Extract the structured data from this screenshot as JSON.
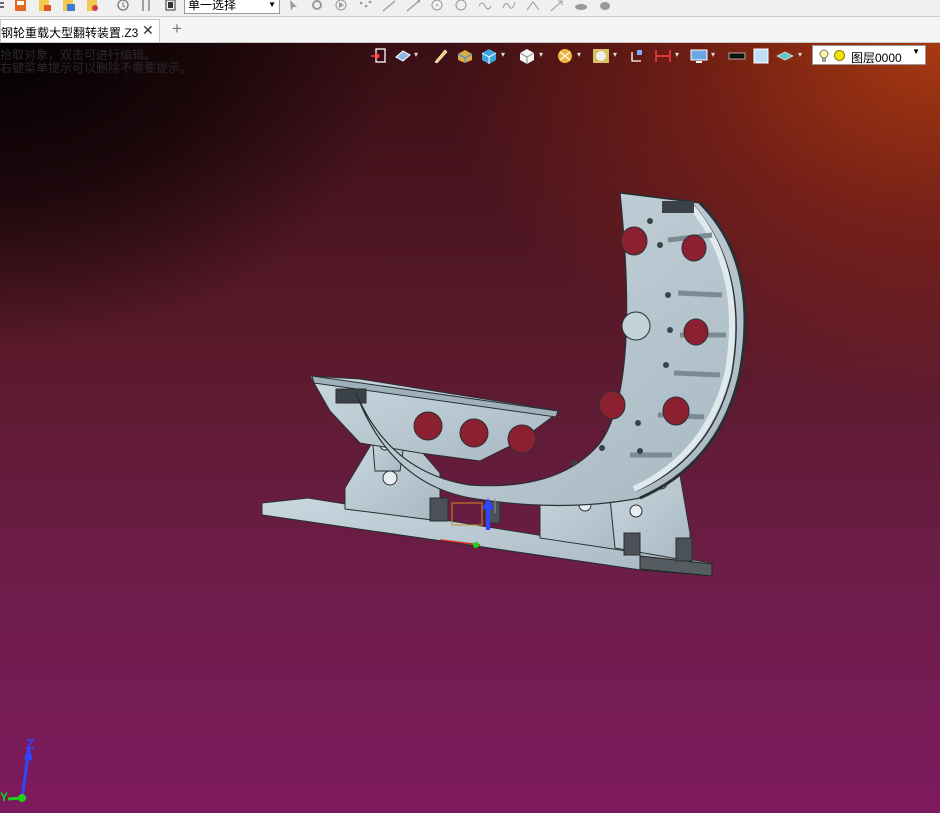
{
  "toolbar": {
    "selection_mode": "单一选择",
    "icons": [
      "list-icon",
      "save-icon",
      "export-icon",
      "import-icon",
      "history-icon",
      "filter-icon",
      "stop-icon",
      "pick-icon",
      "settings-icon",
      "play-icon",
      "points-icon",
      "line-icon",
      "line2-icon",
      "circle-icon",
      "arc-icon",
      "curve-icon",
      "spline-icon",
      "project-icon",
      "arrow-icon",
      "hat-icon",
      "teapot-icon"
    ]
  },
  "tabs": {
    "document_title": "钢轮重载大型翻转装置.Z3",
    "close_symbol": "✕",
    "add_symbol": "+"
  },
  "viewport": {
    "hint_line1": "拾取对象，双击可进行编辑。",
    "hint_line2": "右键菜单提示可以删除不需要提示。",
    "view_tools": [
      "exit-icon",
      "render-mode-icon",
      "pen-icon",
      "shaded-icon",
      "cube-blue-icon",
      "cube-white-icon",
      "section-icon",
      "zoom-icon",
      "rotate-icon",
      "measure-icon",
      "display-icon",
      "color-black-icon",
      "color-box-icon",
      "layer-icon"
    ],
    "layer": {
      "name": "图层0000",
      "status_color": "#f2e300"
    },
    "axes": {
      "z": "Z",
      "y": "Y"
    },
    "colors": {
      "model_fill": "#b9c9d2",
      "model_edge": "#2a2f33",
      "background_top_right": "#a93a10",
      "background_bottom": "#7d1a5e"
    }
  }
}
